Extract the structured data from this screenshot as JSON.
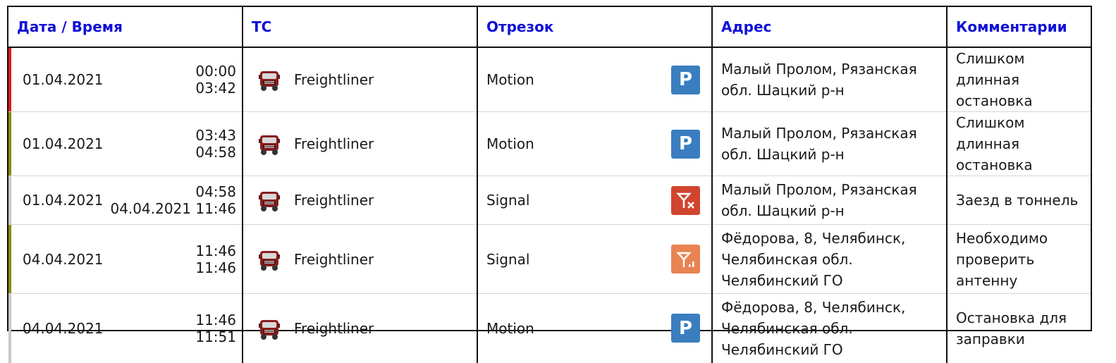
{
  "headers": [
    "Дата / Время",
    "ТС",
    "Отрезок",
    "Адрес",
    "Комментарии"
  ],
  "colors": {
    "header_text": "#1010d8",
    "parking_icon": "#3a7ec0",
    "signal_lost_icon": "#d1452f",
    "signal_weak_icon": "#e98352",
    "stripe_red": "#e01b1b",
    "stripe_olive": "#8b8b12",
    "stripe_gray": "#c8c8c8"
  },
  "rows": [
    {
      "date": "01.04.2021",
      "time_start": "00:00",
      "time_end": "03:42",
      "stripe": "red",
      "vehicle": "Freightliner",
      "segment": "Motion",
      "icon": "parking-icon",
      "address_lines": [
        "Малый Пролом, Рязанская",
        "обл. Шацкий р-н"
      ],
      "comment_lines": [
        "Слишком длинная",
        "остановка"
      ]
    },
    {
      "date": "01.04.2021",
      "time_start": "03:43",
      "time_end": "04:58",
      "stripe": "olive",
      "vehicle": "Freightliner",
      "segment": "Motion",
      "icon": "parking-icon",
      "address_lines": [
        "Малый Пролом, Рязанская",
        "обл. Шацкий р-н"
      ],
      "comment_lines": [
        "Слишком длинная",
        "остановка"
      ]
    },
    {
      "date": "01.04.2021",
      "time_start": "04:58",
      "time_end": "04.04.2021 11:46",
      "stripe": "gray",
      "vehicle": "Freightliner",
      "segment": "Signal",
      "icon": "signal-lost-icon",
      "address_lines": [
        "Малый Пролом, Рязанская",
        "обл. Шацкий р-н"
      ],
      "comment_lines": [
        "Заезд в тоннель"
      ]
    },
    {
      "date": "04.04.2021",
      "time_start": "11:46",
      "time_end": "11:46",
      "stripe": "olive",
      "vehicle": "Freightliner",
      "segment": "Signal",
      "icon": "signal-weak-icon",
      "address_lines": [
        "Фёдорова, 8, Челябинск,",
        "Челябинская обл.",
        "Челябинский ГО"
      ],
      "comment_lines": [
        "Необходимо проверить",
        "антенну"
      ]
    },
    {
      "date": "04.04.2021",
      "time_start": "11:46",
      "time_end": "11:51",
      "stripe": "gray",
      "vehicle": "Freightliner",
      "segment": "Motion",
      "icon": "parking-icon",
      "address_lines": [
        "Фёдорова, 8, Челябинск,",
        "Челябинская обл.",
        "Челябинский ГО"
      ],
      "comment_lines": [
        "Остановка для заправки"
      ]
    }
  ]
}
